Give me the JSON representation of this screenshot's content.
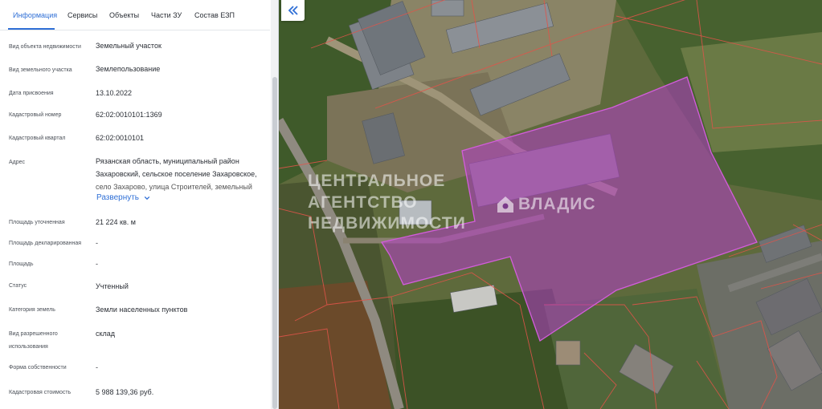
{
  "tabs": [
    {
      "label": "Информация",
      "active": true
    },
    {
      "label": "Сервисы",
      "active": false
    },
    {
      "label": "Объекты",
      "active": false
    },
    {
      "label": "Части ЗУ",
      "active": false
    },
    {
      "label": "Состав ЕЗП",
      "active": false
    }
  ],
  "fields": {
    "object_type": {
      "label": "Вид объекта недвижимости",
      "value": "Земельный участок"
    },
    "land_type": {
      "label": "Вид земельного участка",
      "value": "Землепользование"
    },
    "assign_date": {
      "label": "Дата присвоения",
      "value": "13.10.2022"
    },
    "cad_number": {
      "label": "Кадастровый номер",
      "value": "62:02:0010101:1369"
    },
    "cad_quarter": {
      "label": "Кадастровый квартал",
      "value": "62:02:0010101"
    },
    "address": {
      "label": "Адрес",
      "line1": "Рязанская область, муниципальный район",
      "line2": "Захаровский, сельское поселение Захаровское,",
      "line3": "село Захарово, улица Строителей, земельный",
      "expand": "Развернуть"
    },
    "area_specified": {
      "label": "Площадь уточненная",
      "value": "21 224 кв. м"
    },
    "area_declared": {
      "label": "Площадь декларированная",
      "value": "-"
    },
    "area": {
      "label": "Площадь",
      "value": "-"
    },
    "status": {
      "label": "Статус",
      "value": "Учтенный"
    },
    "land_category": {
      "label": "Категория земель",
      "value": "Земли населенных пунктов"
    },
    "permitted_use": {
      "label_line1": "Вид разрешенного",
      "label_line2": "использования",
      "value": "склад"
    },
    "ownership": {
      "label": "Форма собственности",
      "value": "-"
    },
    "cad_cost": {
      "label": "Кадастровая стоимость",
      "value": "5 988 139,36 руб."
    }
  },
  "map": {
    "collapse_icon": "double-chevron-left-icon",
    "watermark_line1": "ЦЕНТРАЛЬНОЕ",
    "watermark_line2": "АГЕНТСТВО",
    "watermark_line3": "НЕДВИЖИМОСТИ",
    "brand": "ВЛАДИС",
    "brand_icon": "house-logo-icon",
    "parcel_color": "#b43cc8",
    "boundary_color": "#e0544a"
  },
  "colors": {
    "accent": "#2f6fd6",
    "text": "#2b2f36",
    "label": "#4a4f57"
  }
}
